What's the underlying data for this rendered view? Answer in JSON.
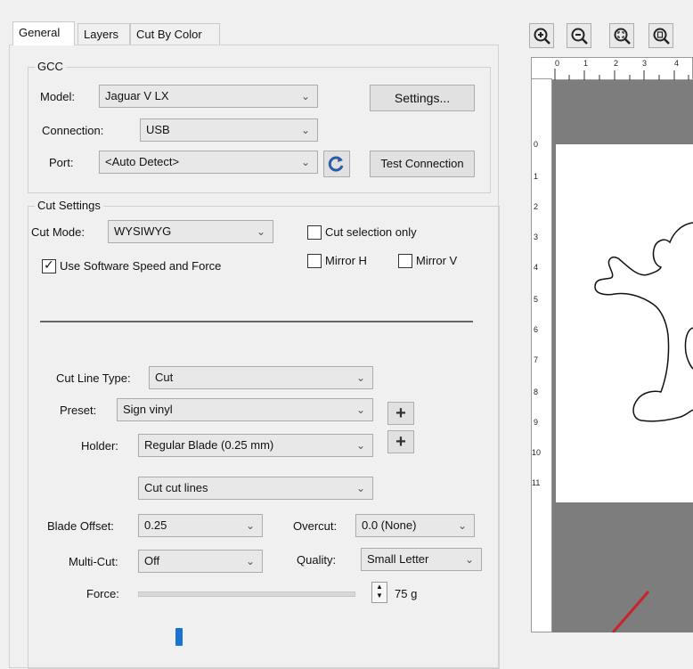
{
  "tabs": [
    "General",
    "Layers",
    "Cut By Color"
  ],
  "gcc": {
    "legend": "GCC",
    "model_label": "Model:",
    "model_value": "Jaguar V LX",
    "settings_button": "Settings...",
    "connection_label": "Connection:",
    "connection_value": "USB",
    "port_label": "Port:",
    "port_value": "<Auto Detect>",
    "test_connection_button": "Test Connection"
  },
  "cut_settings": {
    "legend": "Cut Settings",
    "cut_mode_label": "Cut Mode:",
    "cut_mode_value": "WYSIWYG",
    "cut_selection_only": "Cut selection only",
    "cut_selection_checked": false,
    "use_software_speed": "Use Software Speed and Force",
    "use_software_speed_checked": true,
    "mirror_h": "Mirror H",
    "mirror_v": "Mirror V",
    "cut_line_type_label": "Cut Line Type:",
    "cut_line_type_value": "Cut",
    "preset_label": "Preset:",
    "preset_value": "Sign vinyl",
    "holder_label": "Holder:",
    "holder_value": "Regular Blade (0.25 mm)",
    "cut_lines_value": "Cut cut lines",
    "blade_offset_label": "Blade Offset:",
    "blade_offset_value": "0.25",
    "overcut_label": "Overcut:",
    "overcut_value": "0.0 (None)",
    "multicut_label": "Multi-Cut:",
    "multicut_value": "Off",
    "quality_label": "Quality:",
    "quality_value": "Small Letter",
    "force_label": "Force:",
    "force_value": "75 g",
    "force_fraction": 0.13
  },
  "ruler": {
    "h_ticks": [
      "0",
      "1",
      "2",
      "3",
      "4"
    ],
    "v_ticks": [
      "0",
      "1",
      "2",
      "3",
      "4",
      "5",
      "6",
      "7",
      "8",
      "9",
      "10",
      "11"
    ]
  },
  "icons": {
    "zoom_in": "zoom-in-icon",
    "zoom_out": "zoom-out-icon",
    "zoom_fit": "zoom-fit-icon",
    "zoom_page": "zoom-page-icon",
    "refresh": "refresh-icon"
  }
}
